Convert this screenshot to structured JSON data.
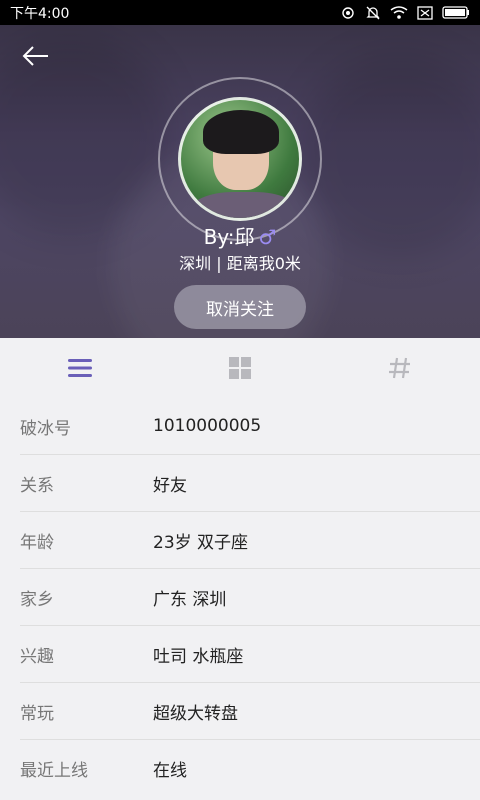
{
  "status_bar": {
    "time": "下午4:00"
  },
  "header": {
    "name": "By:邱",
    "gender_symbol": "♂",
    "location": "深圳 | 距离我0米",
    "follow_button": "取消关注"
  },
  "colors": {
    "accent": "#6a5fb8",
    "header_bg": "#4a4160",
    "gender": "#9b8cf2"
  },
  "icons": {
    "back": "arrow-left-icon",
    "tab_list": "list-icon",
    "tab_grid": "grid-icon",
    "tab_tag": "hashtag-icon"
  },
  "profile": {
    "rows": [
      {
        "label": "破冰号",
        "value": "1010000005"
      },
      {
        "label": "关系",
        "value": "好友"
      },
      {
        "label": "年龄",
        "value": "23岁 双子座"
      },
      {
        "label": "家乡",
        "value": "广东 深圳"
      },
      {
        "label": "兴趣",
        "value": "吐司 水瓶座"
      },
      {
        "label": "常玩",
        "value": "超级大转盘"
      },
      {
        "label": "最近上线",
        "value": "在线"
      }
    ]
  }
}
